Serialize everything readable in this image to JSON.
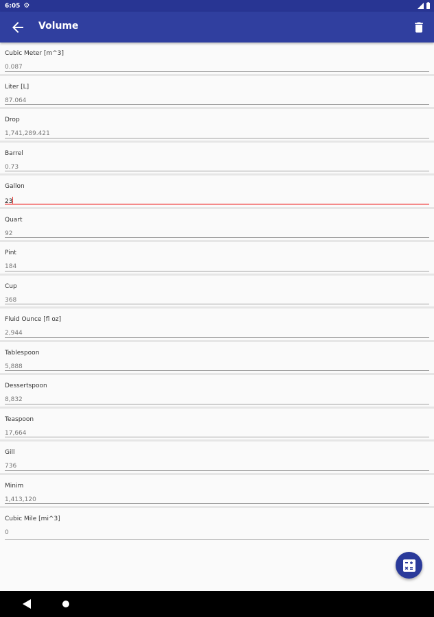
{
  "status_bar": {
    "time": "6:05"
  },
  "app_bar": {
    "title": "Volume"
  },
  "fields": [
    {
      "label": "Cubic Meter [m^3]",
      "value": "0.087"
    },
    {
      "label": "Liter [L]",
      "value": "87.064"
    },
    {
      "label": "Drop",
      "value": "1,741,289.421"
    },
    {
      "label": "Barrel",
      "value": "0.73"
    },
    {
      "label": "Gallon",
      "value": "23"
    },
    {
      "label": "Quart",
      "value": "92"
    },
    {
      "label": "Pint",
      "value": "184"
    },
    {
      "label": "Cup",
      "value": "368"
    },
    {
      "label": "Fluid Ounce [fl oz]",
      "value": "2,944"
    },
    {
      "label": "Tablespoon",
      "value": "5,888"
    },
    {
      "label": "Dessertspoon",
      "value": "8,832"
    },
    {
      "label": "Teaspoon",
      "value": "17,664"
    },
    {
      "label": "Gill",
      "value": "736"
    },
    {
      "label": "Minim",
      "value": "1,413,120"
    },
    {
      "label": "Cubic Mile [mi^3]",
      "value": "0"
    }
  ],
  "colors": {
    "status_bar": "#283593",
    "app_bar": "#303f9f",
    "fab": "#2a3a9a",
    "active_underline": "#f48a8a"
  },
  "icons": {
    "back": "arrow-back-icon",
    "delete": "trash-icon",
    "fab": "calculator-icon",
    "settings": "gear-icon"
  }
}
